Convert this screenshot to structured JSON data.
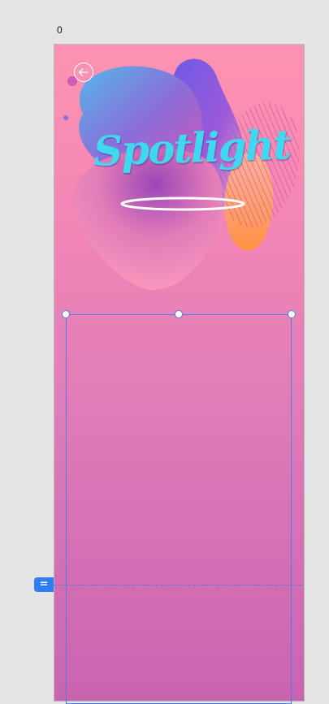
{
  "canvas": {
    "artboard_label": "0"
  },
  "artboard": {
    "title": "Spotlight",
    "back_icon": "arrow-left-circle-icon"
  },
  "guide": {
    "handle_label": "="
  },
  "colors": {
    "title": "#3ed8ef",
    "selection": "#4a7de6",
    "guide_handle": "#2f7df6",
    "background_top": "#fd93b2",
    "background_bottom": "#c964b2"
  }
}
